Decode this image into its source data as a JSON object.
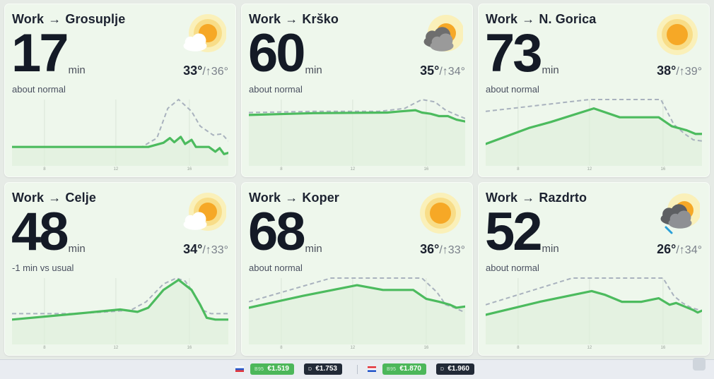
{
  "cards": [
    {
      "route_from": "Work",
      "arrow": "→",
      "route_to": "Grosuplje",
      "minutes": "17",
      "unit": "min",
      "temp": "33°",
      "temp_high": "/↑36°",
      "status": "about normal",
      "weather_icon": "sun-behind-cloud-icon",
      "ticks": [
        {
          "label": "8",
          "t": 0.15
        },
        {
          "label": "12",
          "t": 0.48
        },
        {
          "label": "16",
          "t": 0.82
        }
      ],
      "usual": [
        [
          0,
          0.2
        ],
        [
          0.3,
          0.2
        ],
        [
          0.6,
          0.2
        ],
        [
          0.67,
          0.35
        ],
        [
          0.72,
          0.85
        ],
        [
          0.77,
          1.0
        ],
        [
          0.83,
          0.8
        ],
        [
          0.87,
          0.55
        ],
        [
          0.93,
          0.4
        ],
        [
          0.97,
          0.42
        ],
        [
          1,
          0.3
        ]
      ],
      "current": [
        [
          0,
          0.2
        ],
        [
          0.3,
          0.2
        ],
        [
          0.63,
          0.2
        ],
        [
          0.7,
          0.27
        ],
        [
          0.73,
          0.35
        ],
        [
          0.75,
          0.28
        ],
        [
          0.78,
          0.37
        ],
        [
          0.8,
          0.25
        ],
        [
          0.83,
          0.32
        ],
        [
          0.85,
          0.2
        ],
        [
          0.91,
          0.2
        ],
        [
          0.94,
          0.12
        ],
        [
          0.96,
          0.18
        ],
        [
          0.98,
          0.08
        ],
        [
          1,
          0.1
        ]
      ]
    },
    {
      "route_from": "Work",
      "arrow": "→",
      "route_to": "Krško",
      "minutes": "60",
      "unit": "min",
      "temp": "35°",
      "temp_high": "/↑34°",
      "status": "about normal",
      "weather_icon": "cloud-sun-icon",
      "ticks": [
        {
          "label": "8",
          "t": 0.15
        },
        {
          "label": "12",
          "t": 0.48
        },
        {
          "label": "16",
          "t": 0.82
        }
      ],
      "usual": [
        [
          0,
          0.78
        ],
        [
          0.3,
          0.8
        ],
        [
          0.6,
          0.8
        ],
        [
          0.65,
          0.82
        ],
        [
          0.72,
          0.85
        ],
        [
          0.8,
          1.0
        ],
        [
          0.86,
          0.96
        ],
        [
          0.91,
          0.82
        ],
        [
          0.96,
          0.74
        ],
        [
          1,
          0.68
        ]
      ],
      "current": [
        [
          0,
          0.74
        ],
        [
          0.3,
          0.77
        ],
        [
          0.64,
          0.78
        ],
        [
          0.7,
          0.8
        ],
        [
          0.77,
          0.82
        ],
        [
          0.8,
          0.78
        ],
        [
          0.84,
          0.76
        ],
        [
          0.88,
          0.72
        ],
        [
          0.92,
          0.72
        ],
        [
          0.96,
          0.66
        ],
        [
          1,
          0.63
        ]
      ]
    },
    {
      "route_from": "Work",
      "arrow": "→",
      "route_to": "N. Gorica",
      "minutes": "73",
      "unit": "min",
      "temp": "38°",
      "temp_high": "/↑39°",
      "status": "about normal",
      "weather_icon": "sun-icon",
      "ticks": [
        {
          "label": "8",
          "t": 0.15
        },
        {
          "label": "12",
          "t": 0.48
        },
        {
          "label": "16",
          "t": 0.82
        }
      ],
      "usual": [
        [
          0,
          0.8
        ],
        [
          0.48,
          1.0
        ],
        [
          0.81,
          1.0
        ],
        [
          0.87,
          0.58
        ],
        [
          0.92,
          0.42
        ],
        [
          0.96,
          0.32
        ],
        [
          1,
          0.3
        ]
      ],
      "current": [
        [
          0,
          0.25
        ],
        [
          0.2,
          0.52
        ],
        [
          0.3,
          0.62
        ],
        [
          0.5,
          0.85
        ],
        [
          0.62,
          0.7
        ],
        [
          0.75,
          0.7
        ],
        [
          0.8,
          0.7
        ],
        [
          0.86,
          0.55
        ],
        [
          0.93,
          0.48
        ],
        [
          0.97,
          0.42
        ],
        [
          1,
          0.42
        ]
      ]
    },
    {
      "route_from": "Work",
      "arrow": "→",
      "route_to": "Celje",
      "minutes": "48",
      "unit": "min",
      "temp": "34°",
      "temp_high": "/↑33°",
      "status": "-1 min vs usual",
      "weather_icon": "sun-behind-cloud-icon",
      "ticks": [
        {
          "label": "8",
          "t": 0.15
        },
        {
          "label": "12",
          "t": 0.48
        },
        {
          "label": "16",
          "t": 0.82
        }
      ],
      "usual": [
        [
          0,
          0.4
        ],
        [
          0.3,
          0.4
        ],
        [
          0.48,
          0.44
        ],
        [
          0.55,
          0.46
        ],
        [
          0.62,
          0.6
        ],
        [
          0.7,
          0.9
        ],
        [
          0.76,
          1.0
        ],
        [
          0.8,
          0.95
        ],
        [
          0.84,
          0.75
        ],
        [
          0.88,
          0.46
        ],
        [
          0.92,
          0.4
        ],
        [
          1,
          0.4
        ]
      ],
      "current": [
        [
          0,
          0.3
        ],
        [
          0.3,
          0.4
        ],
        [
          0.5,
          0.47
        ],
        [
          0.58,
          0.43
        ],
        [
          0.63,
          0.5
        ],
        [
          0.7,
          0.8
        ],
        [
          0.77,
          0.97
        ],
        [
          0.83,
          0.8
        ],
        [
          0.87,
          0.55
        ],
        [
          0.9,
          0.33
        ],
        [
          0.94,
          0.3
        ],
        [
          1,
          0.3
        ]
      ]
    },
    {
      "route_from": "Work",
      "arrow": "→",
      "route_to": "Koper",
      "minutes": "68",
      "unit": "min",
      "temp": "36°",
      "temp_high": "/↑33°",
      "status": "about normal",
      "weather_icon": "sun-icon",
      "ticks": [
        {
          "label": "8",
          "t": 0.15
        },
        {
          "label": "12",
          "t": 0.48
        },
        {
          "label": "16",
          "t": 0.82
        }
      ],
      "usual": [
        [
          0,
          0.6
        ],
        [
          0.38,
          1.0
        ],
        [
          0.8,
          1.0
        ],
        [
          0.87,
          0.76
        ],
        [
          0.91,
          0.55
        ],
        [
          0.95,
          0.5
        ],
        [
          1,
          0.42
        ]
      ],
      "current": [
        [
          0,
          0.5
        ],
        [
          0.25,
          0.7
        ],
        [
          0.5,
          0.88
        ],
        [
          0.62,
          0.8
        ],
        [
          0.76,
          0.8
        ],
        [
          0.82,
          0.65
        ],
        [
          0.88,
          0.6
        ],
        [
          0.93,
          0.55
        ],
        [
          0.96,
          0.5
        ],
        [
          1,
          0.52
        ]
      ]
    },
    {
      "route_from": "Work",
      "arrow": "→",
      "route_to": "Razdrto",
      "minutes": "52",
      "unit": "min",
      "temp": "26°",
      "temp_high": "/↑34°",
      "status": "about normal",
      "weather_icon": "rain-cloud-icon",
      "ticks": [
        {
          "label": "8",
          "t": 0.15
        },
        {
          "label": "12",
          "t": 0.48
        },
        {
          "label": "16",
          "t": 0.82
        }
      ],
      "usual": [
        [
          0,
          0.55
        ],
        [
          0.4,
          1.0
        ],
        [
          0.82,
          1.0
        ],
        [
          0.87,
          0.7
        ],
        [
          0.91,
          0.58
        ],
        [
          0.95,
          0.5
        ],
        [
          1,
          0.45
        ]
      ],
      "current": [
        [
          0,
          0.38
        ],
        [
          0.25,
          0.6
        ],
        [
          0.49,
          0.78
        ],
        [
          0.55,
          0.72
        ],
        [
          0.63,
          0.6
        ],
        [
          0.72,
          0.6
        ],
        [
          0.8,
          0.66
        ],
        [
          0.85,
          0.55
        ],
        [
          0.88,
          0.58
        ],
        [
          0.92,
          0.52
        ],
        [
          0.96,
          0.46
        ],
        [
          0.98,
          0.42
        ],
        [
          1,
          0.45
        ]
      ]
    }
  ],
  "fuel_bar": {
    "groups": [
      {
        "country_flag": "slovenia-flag",
        "prices": [
          {
            "label": "B95",
            "value": "€1.519",
            "style": "green"
          },
          {
            "label": "D",
            "value": "€1.753",
            "style": "dark"
          }
        ]
      },
      {
        "country_flag": "croatia-flag",
        "prices": [
          {
            "label": "B95",
            "value": "€1.870",
            "style": "green"
          },
          {
            "label": "D",
            "value": "€1.960",
            "style": "dark"
          }
        ]
      }
    ]
  },
  "colors": {
    "line": "#4cbb5e",
    "usual": "#a9b2be",
    "fill": "#dcefd8",
    "card_bg": "#eef7ec",
    "text": "#141a26"
  }
}
